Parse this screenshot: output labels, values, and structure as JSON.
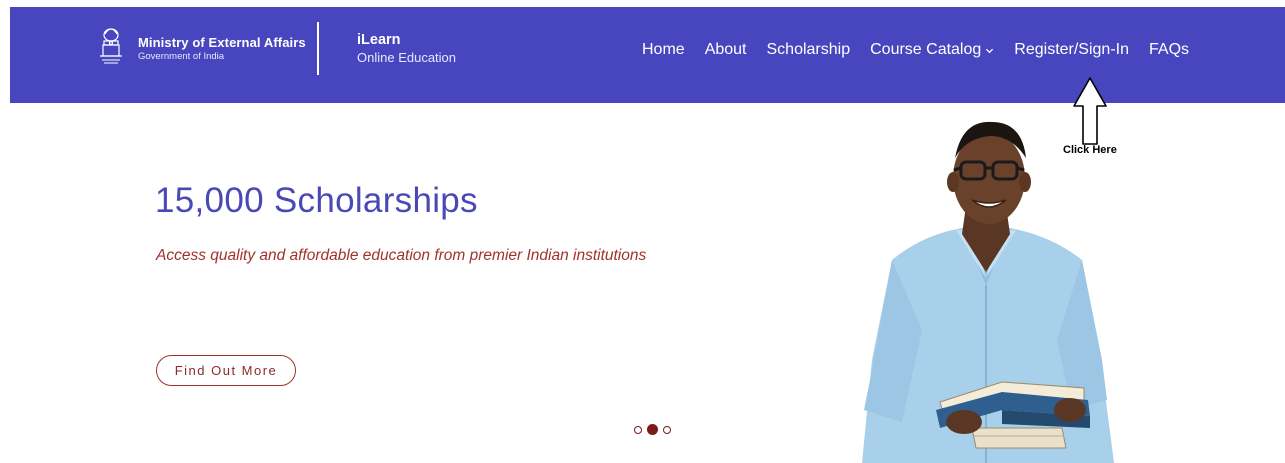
{
  "header": {
    "org_title": "Ministry of External Affairs",
    "org_subtitle": "Government of India",
    "brand_title": "iLearn",
    "brand_subtitle": "Online Education",
    "nav": {
      "home": "Home",
      "about": "About",
      "scholarship": "Scholarship",
      "course_catalog": "Course Catalog",
      "register": "Register/Sign-In",
      "faqs": "FAQs"
    },
    "emblem_icon": "national-emblem-icon",
    "caret_icon": "chevron-down-icon"
  },
  "hero": {
    "title": "15,000 Scholarships",
    "subtitle": "Access quality and affordable education from premier Indian institutions",
    "cta_label": "Find Out More",
    "slides_total": 3,
    "active_slide": 2,
    "image": "smiling student holding open books"
  },
  "annotation": {
    "text": "Click Here",
    "arrow_icon": "up-arrow-outline-icon"
  },
  "colors": {
    "navbar": "#4846bf",
    "title": "#4a48b5",
    "subtitle": "#a0322c",
    "dot": "#7a1a1a"
  }
}
